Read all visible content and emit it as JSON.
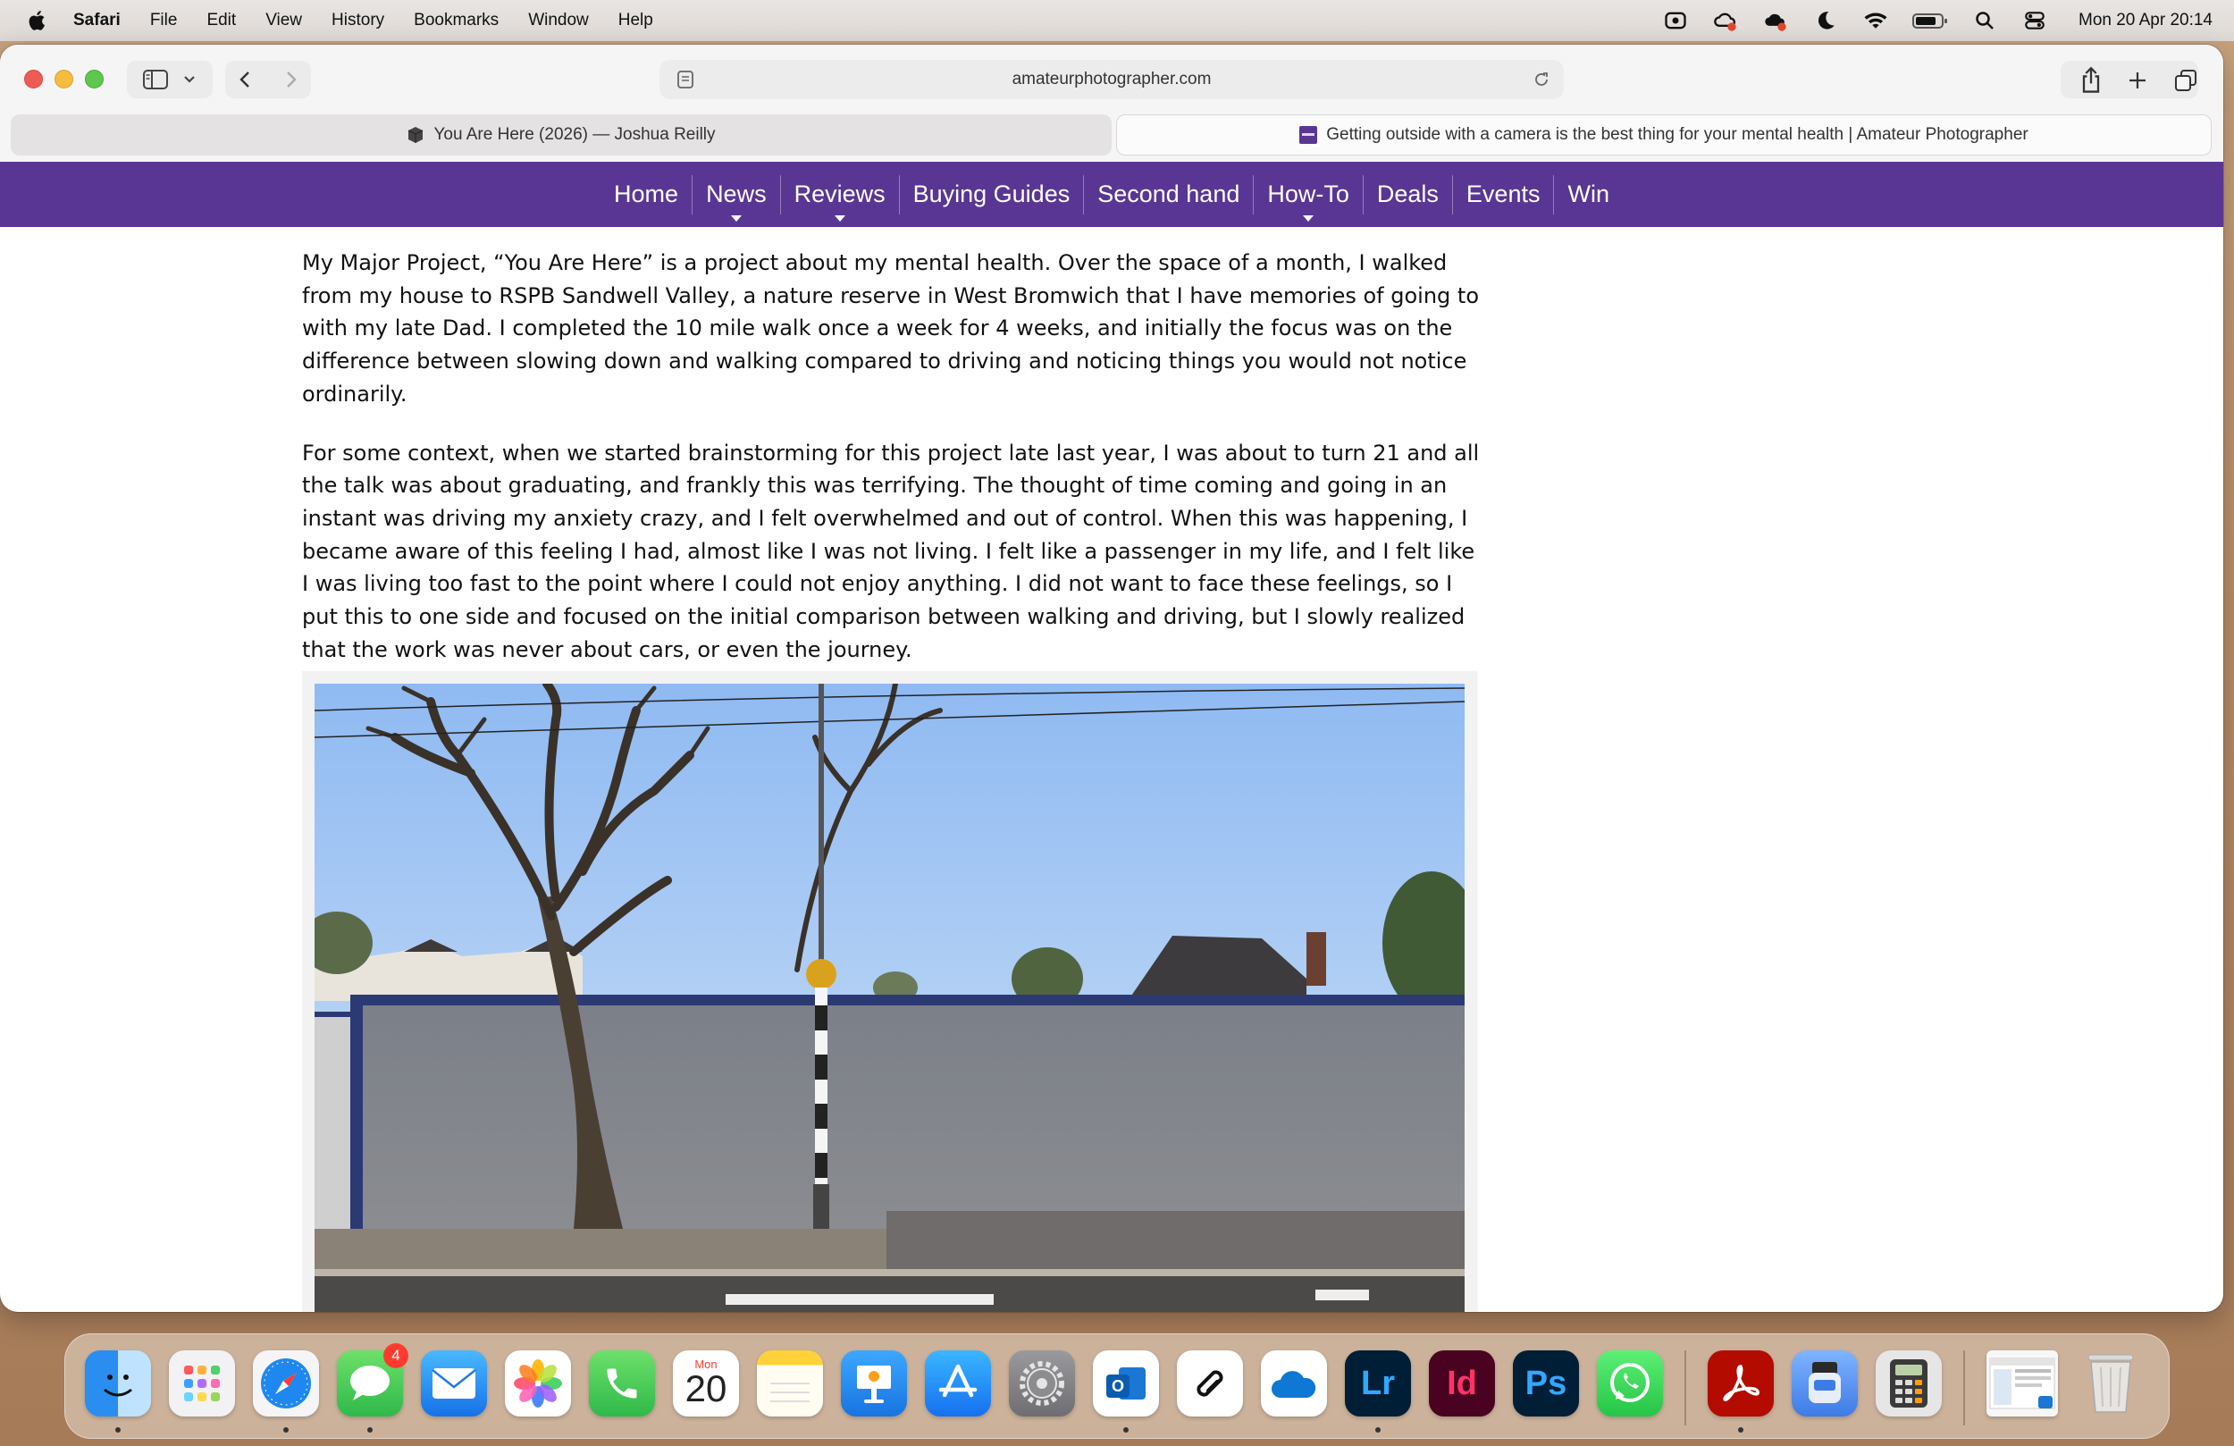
{
  "menubar": {
    "items": [
      "Safari",
      "File",
      "Edit",
      "View",
      "History",
      "Bookmarks",
      "Window",
      "Help"
    ],
    "clock": "Mon 20 Apr  20:14",
    "status_icons": [
      "creative-cloud-icon",
      "creative-cloud-sync-icon",
      "cloud-alert-icon",
      "moon-icon",
      "wifi-icon",
      "battery-icon",
      "search-icon",
      "control-center-icon"
    ]
  },
  "browser": {
    "address": "amateurphotographer.com",
    "tabs": [
      {
        "title": "You Are Here (2026) — Joshua Reilly",
        "active": false
      },
      {
        "title": "Getting outside with a camera is the best thing for your mental health | Amateur Photographer",
        "active": true
      }
    ]
  },
  "sitenav": {
    "items": [
      "Home",
      "News",
      "Reviews",
      "Buying Guides",
      "Second hand",
      "How-To",
      "Deals",
      "Events",
      "Win"
    ],
    "has_dropdown": [
      false,
      true,
      true,
      false,
      false,
      true,
      false,
      false,
      false
    ],
    "background": "#5a3694"
  },
  "article": {
    "paragraphs": [
      "My Major Project, “You Are Here” is a project about my mental health. Over the space of a month, I walked from my house to RSPB Sandwell Valley, a nature reserve in West Bromwich that I have memories of going to with my late Dad. I completed the 10 mile walk once a week for 4 weeks, and initially the focus was on the difference between slowing down and walking compared to driving and noticing things you would not notice ordinarily.",
      "For some context, when we started brainstorming for this project late last year, I was about to turn 21 and all the talk was about graduating, and frankly this was terrifying. The thought of time coming and going in an instant was driving my anxiety crazy, and I felt overwhelmed and out of control. When this was happening, I became aware of this feeling I had, almost like I was not living. I felt like a passenger in my life, and I felt like I was living too fast to the point where I could not enjoy anything. I did not want to face these feelings, so I put this to one side and focused on the initial comparison between walking and driving, but I slowly realized that the work was never about cars, or even the journey."
    ]
  },
  "dock": {
    "calendar_month": "Mon",
    "calendar_day": "20",
    "messages_badge": "4",
    "lightroom_label": "Lr",
    "indesign_label": "Id",
    "photoshop_label": "Ps"
  }
}
